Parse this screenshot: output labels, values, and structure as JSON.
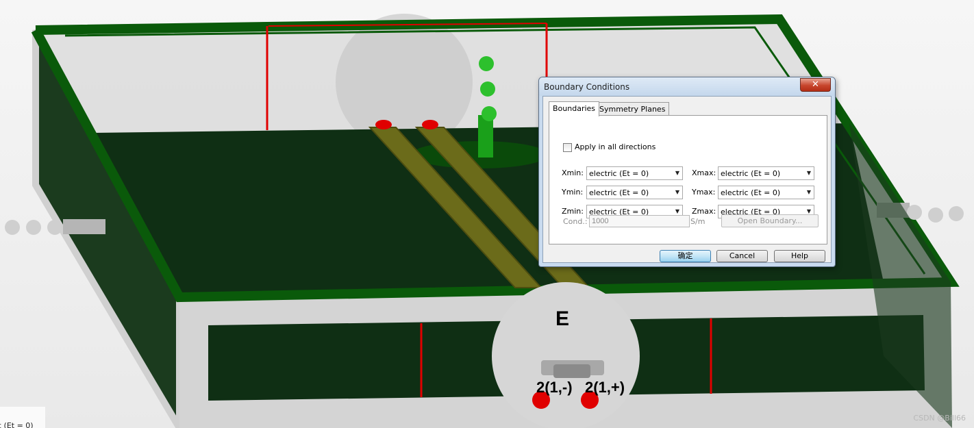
{
  "viewport": {
    "e_label": "E",
    "port_neg_label": "2(1,-)",
    "port_pos_label": "2(1,+)",
    "watermark": "CSDN @Bill66",
    "partial_panel_text": "c (Et = 0)"
  },
  "dialog": {
    "title": "Boundary Conditions",
    "close_glyph": "✕",
    "tabs": [
      {
        "label": "Boundaries",
        "active": true
      },
      {
        "label": "Symmetry Planes",
        "active": false
      }
    ],
    "apply_all_label": "Apply in all directions",
    "apply_all_checked": false,
    "rows": [
      {
        "min_label": "Xmin:",
        "min_value": "electric (Et = 0)",
        "max_label": "Xmax:",
        "max_value": "electric (Et = 0)"
      },
      {
        "min_label": "Ymin:",
        "min_value": "electric (Et = 0)",
        "max_label": "Ymax:",
        "max_value": "electric (Et = 0)"
      },
      {
        "min_label": "Zmin:",
        "min_value": "electric (Et = 0)",
        "max_label": "Zmax:",
        "max_value": "electric (Et = 0)"
      }
    ],
    "cond_label": "Cond.:",
    "cond_value": "1000",
    "cond_unit": "S/m",
    "open_boundary_label": "Open Boundary...",
    "ok_label": "确定",
    "cancel_label": "Cancel",
    "help_label": "Help"
  },
  "colors": {
    "frame_green": "#0a5a0a",
    "board_green": "#0f2f14",
    "strip_olive": "#6b6b1a",
    "port_red": "#e00000",
    "boundary_gray": "#d4d4d4"
  }
}
